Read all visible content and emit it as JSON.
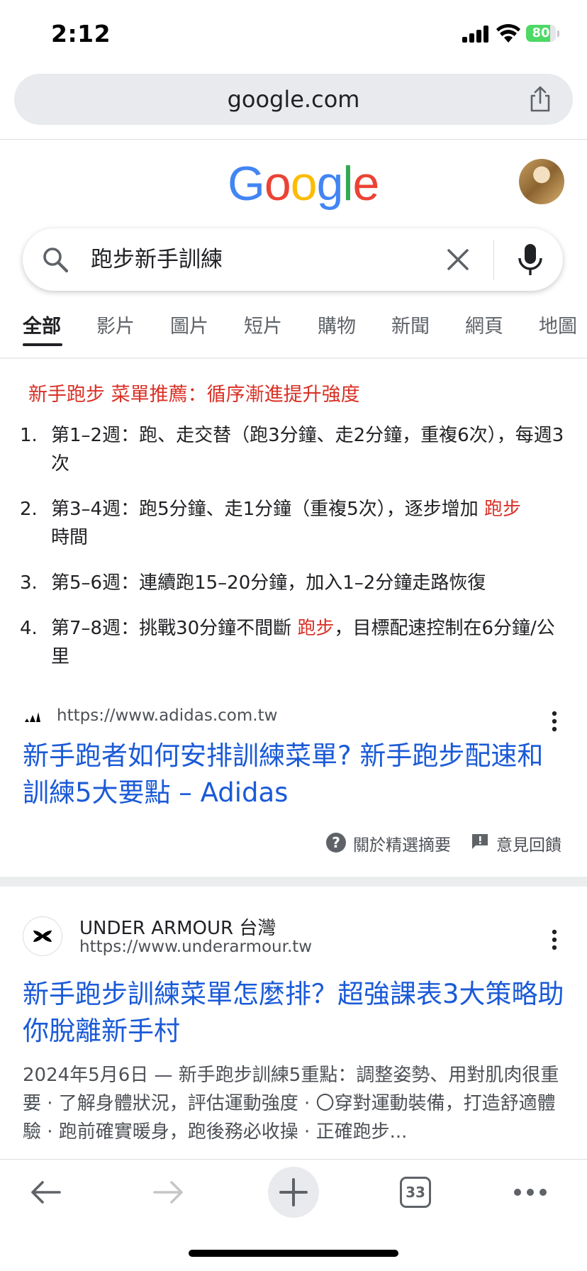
{
  "status_bar": {
    "time": "2:12",
    "battery": "80",
    "battery_level": 0.8
  },
  "browser": {
    "url": "google.com"
  },
  "google": {
    "logo_letters": [
      {
        "ch": "G",
        "color": "#4285F4"
      },
      {
        "ch": "o",
        "color": "#EA4335"
      },
      {
        "ch": "o",
        "color": "#FBBC05"
      },
      {
        "ch": "g",
        "color": "#4285F4"
      },
      {
        "ch": "l",
        "color": "#34A853"
      },
      {
        "ch": "e",
        "color": "#EA4335"
      }
    ]
  },
  "search": {
    "query": "跑步新手訓練"
  },
  "tabs": [
    "全部",
    "影片",
    "圖片",
    "短片",
    "購物",
    "新聞",
    "網頁",
    "地圖"
  ],
  "snippet": {
    "heading": "新手跑步 菜單推薦：循序漸進提升強度",
    "items": [
      {
        "num": "1.",
        "text": "第1–2週：跑、走交替（跑3分鐘、走2分鐘，重複6次），每週3次"
      },
      {
        "num": "2.",
        "text_a": "第3–4週：跑5分鐘、走1分鐘（重複5次），逐步增加 ",
        "highlight": "跑步",
        "text_b": "時間"
      },
      {
        "num": "3.",
        "text": "第5–6週：連續跑15–20分鐘，加入1–2分鐘走路恢復"
      },
      {
        "num": "4.",
        "text_a": "第7–8週：挑戰30分鐘不間斷 ",
        "highlight": "跑步",
        "text_b": "，目標配速控制在6分鐘/公里"
      }
    ],
    "source_url": "https://www.adidas.com.tw",
    "title": "新手跑者如何安排訓練菜單? 新手跑步配速和訓練5大要點 – Adidas",
    "about_label": "關於精選摘要",
    "feedback_label": "意見回饋"
  },
  "result2": {
    "site_name": "UNDER ARMOUR 台灣",
    "url": "https://www.underarmour.tw",
    "title": "新手跑步訓練菜單怎麼排？超強課表3大策略助你脫離新手村",
    "snippet": "2024年5月6日 — 新手跑步訓練5重點：調整姿勢、用對肌肉很重要 · 了解身體狀況，評估運動強度 · 〇穿對運動裝備，打造舒適體驗 · 跑前確實暖身，跑後務必收操 · 正確跑步..."
  },
  "toolbar": {
    "tab_count": "33"
  }
}
